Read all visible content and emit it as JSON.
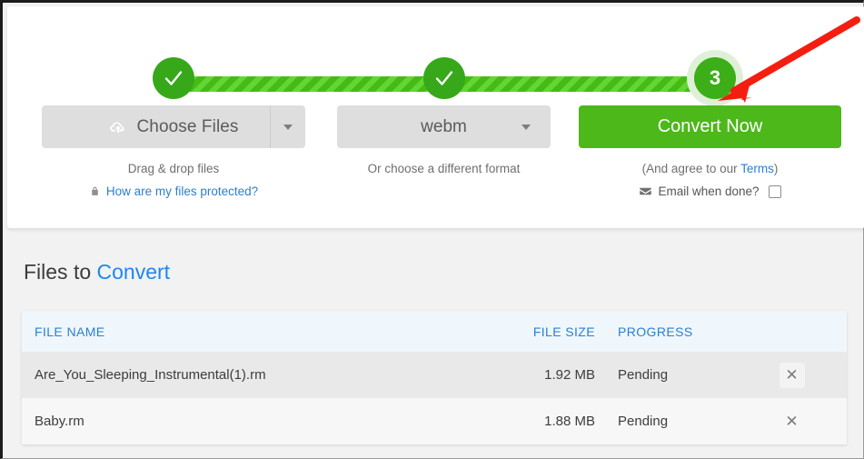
{
  "stepper": {
    "step1_state": "complete",
    "step1_icon": "check-icon",
    "step2_state": "complete",
    "step2_icon": "check-icon",
    "step3_label": "3",
    "step3_state": "active"
  },
  "annotation": {
    "arrow_color": "#f41e10",
    "arrow_target": "convert-now-button"
  },
  "actions": {
    "choose_files": {
      "label": "Choose Files",
      "icon": "cloud-upload-icon",
      "dropdown_icon": "caret-down-icon",
      "helper": "Drag & drop files",
      "protected_link": "How are my files protected?",
      "protected_icon": "lock-icon"
    },
    "format": {
      "value": "webm",
      "dropdown_icon": "caret-down-icon",
      "helper": "Or choose a different format"
    },
    "convert": {
      "label": "Convert Now",
      "terms_prefix": "(And agree to our ",
      "terms_link": "Terms",
      "terms_suffix": ")",
      "email_icon": "envelope-icon",
      "email_label": "Email when done?",
      "email_checked": false
    }
  },
  "files_section": {
    "heading_prefix": "Files to ",
    "heading_highlight": "Convert",
    "columns": {
      "name": "FILE NAME",
      "size": "FILE SIZE",
      "progress": "PROGRESS"
    },
    "rows": [
      {
        "name": "Are_You_Sleeping_Instrumental(1).rm",
        "size": "1.92 MB",
        "progress": "Pending",
        "delete_icon": "close-icon"
      },
      {
        "name": "Baby.rm",
        "size": "1.88 MB",
        "progress": "Pending",
        "delete_icon": "close-icon"
      }
    ]
  },
  "colors": {
    "green_primary": "#4cb81a",
    "green_step": "#36a81a",
    "link_blue": "#2a7fd4",
    "heading_blue": "#1e87ef",
    "arrow_red": "#f41e10"
  }
}
